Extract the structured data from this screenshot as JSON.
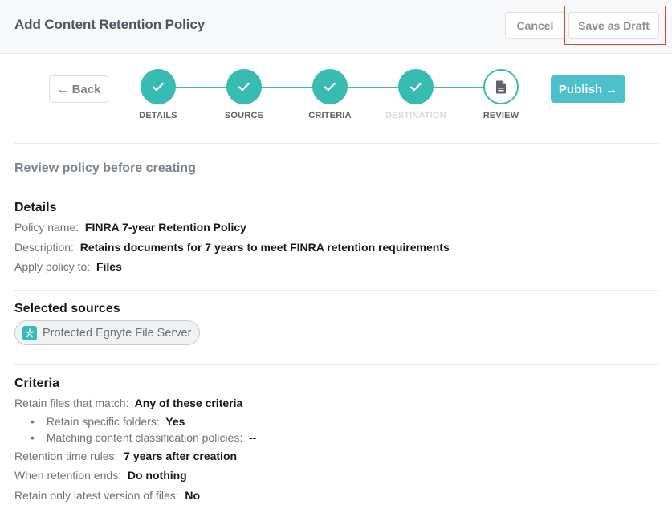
{
  "header": {
    "title": "Add Content Retention Policy",
    "cancel_label": "Cancel",
    "save_draft_label": "Save as Draft"
  },
  "wizard": {
    "back_label": "Back",
    "back_icon": "arrow-left-icon",
    "publish_label": "Publish",
    "publish_icon": "arrow-right-icon",
    "accent_color": "#37bbb2",
    "steps": [
      {
        "label": "DETAILS",
        "state": "completed",
        "icon": "check-icon"
      },
      {
        "label": "SOURCE",
        "state": "completed",
        "icon": "check-icon"
      },
      {
        "label": "CRITERIA",
        "state": "completed",
        "icon": "check-icon"
      },
      {
        "label": "DESTINATION",
        "state": "disabled",
        "icon": "check-icon"
      },
      {
        "label": "REVIEW",
        "state": "current",
        "icon": "document-icon"
      }
    ]
  },
  "review": {
    "subtitle": "Review policy before creating",
    "details": {
      "title": "Details",
      "rows": [
        {
          "label": "Policy name:",
          "value": "FINRA 7-year Retention Policy"
        },
        {
          "label": "Description:",
          "value": "Retains documents for 7 years to meet FINRA retention requirements"
        },
        {
          "label": "Apply policy to:",
          "value": "Files"
        }
      ]
    },
    "sources": {
      "title": "Selected sources",
      "items": [
        {
          "label": "Protected Egnyte File Server",
          "icon": "egnyte-logo-icon"
        }
      ]
    },
    "criteria": {
      "title": "Criteria",
      "match": {
        "label": "Retain files that match:",
        "value": "Any of these criteria"
      },
      "bullets": [
        {
          "label": "Retain specific folders:",
          "value": "Yes"
        },
        {
          "label": "Matching content classification policies:",
          "value": "--"
        }
      ],
      "rows": [
        {
          "label": "Retention time rules:",
          "value": "7 years after creation"
        },
        {
          "label": "When retention ends:",
          "value": "Do nothing"
        },
        {
          "label": "Retain only latest version of files:",
          "value": "No"
        }
      ]
    }
  }
}
